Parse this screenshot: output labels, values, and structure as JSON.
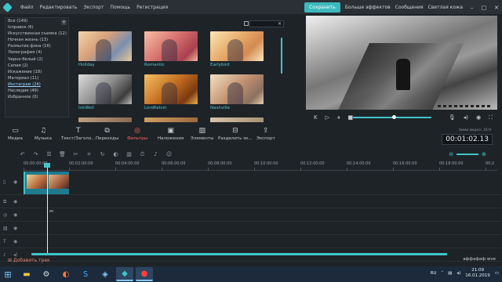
{
  "menu": {
    "items": [
      "Файл",
      "Редактировать",
      "Экспорт",
      "Помощь",
      "Регистрация"
    ],
    "save": "Сохранить",
    "links": [
      "Больше эффектов",
      "Сообщения",
      "Светлая кожа"
    ]
  },
  "categories": {
    "items": [
      "Все (149)",
      "Ісправок (6)",
      "Искусственная съемка (12)",
      "Ночная жизнь (13)",
      "Размытие фона (16)",
      "Ломография (4)",
      "Черно-белый (2)",
      "Сепия (2)",
      "Искажение (18)",
      "Материал (11)",
      "Инстаграм (24)",
      "Наследие (49)",
      "Избранное (0)"
    ],
    "selected_index": 10
  },
  "search": {
    "placeholder": ""
  },
  "effects": [
    {
      "label": "Holiday"
    },
    {
      "label": "Romantic"
    },
    {
      "label": "Earlybird"
    },
    {
      "label": "InkWell"
    },
    {
      "label": "LordKelvin"
    },
    {
      "label": "Nashville"
    },
    {
      "label": ""
    },
    {
      "label": ""
    },
    {
      "label": ""
    }
  ],
  "tools": [
    "Медиа",
    "Музыка",
    "Текст/Заголо...",
    "Переходы",
    "Фильтры",
    "Наложения",
    "Элементы",
    "Разделить эк...",
    "Экспорт"
  ],
  "active_tool_index": 4,
  "timecode": {
    "label": "Ними видео: 16:9",
    "value": "00:01:02.13"
  },
  "ruler": [
    "00:00:00:00",
    "00:02:00:00",
    "00:04:00:00",
    "00:06:00:00",
    "00:08:00:00",
    "00:10:00:00",
    "00:12:00:00",
    "00:14:00:00",
    "00:16:00:00",
    "00:18:00:00",
    "00:2"
  ],
  "bottom": {
    "add_track": "Добавить трек",
    "project": "аффафаф.wve"
  },
  "taskbar": {
    "lang": "RU",
    "time": "21:09",
    "date": "16.01.2019"
  },
  "colors": {
    "accent": "#3ec6c9",
    "active_tool": "#ff6a5a",
    "taskbar": "#1c2a3b"
  }
}
